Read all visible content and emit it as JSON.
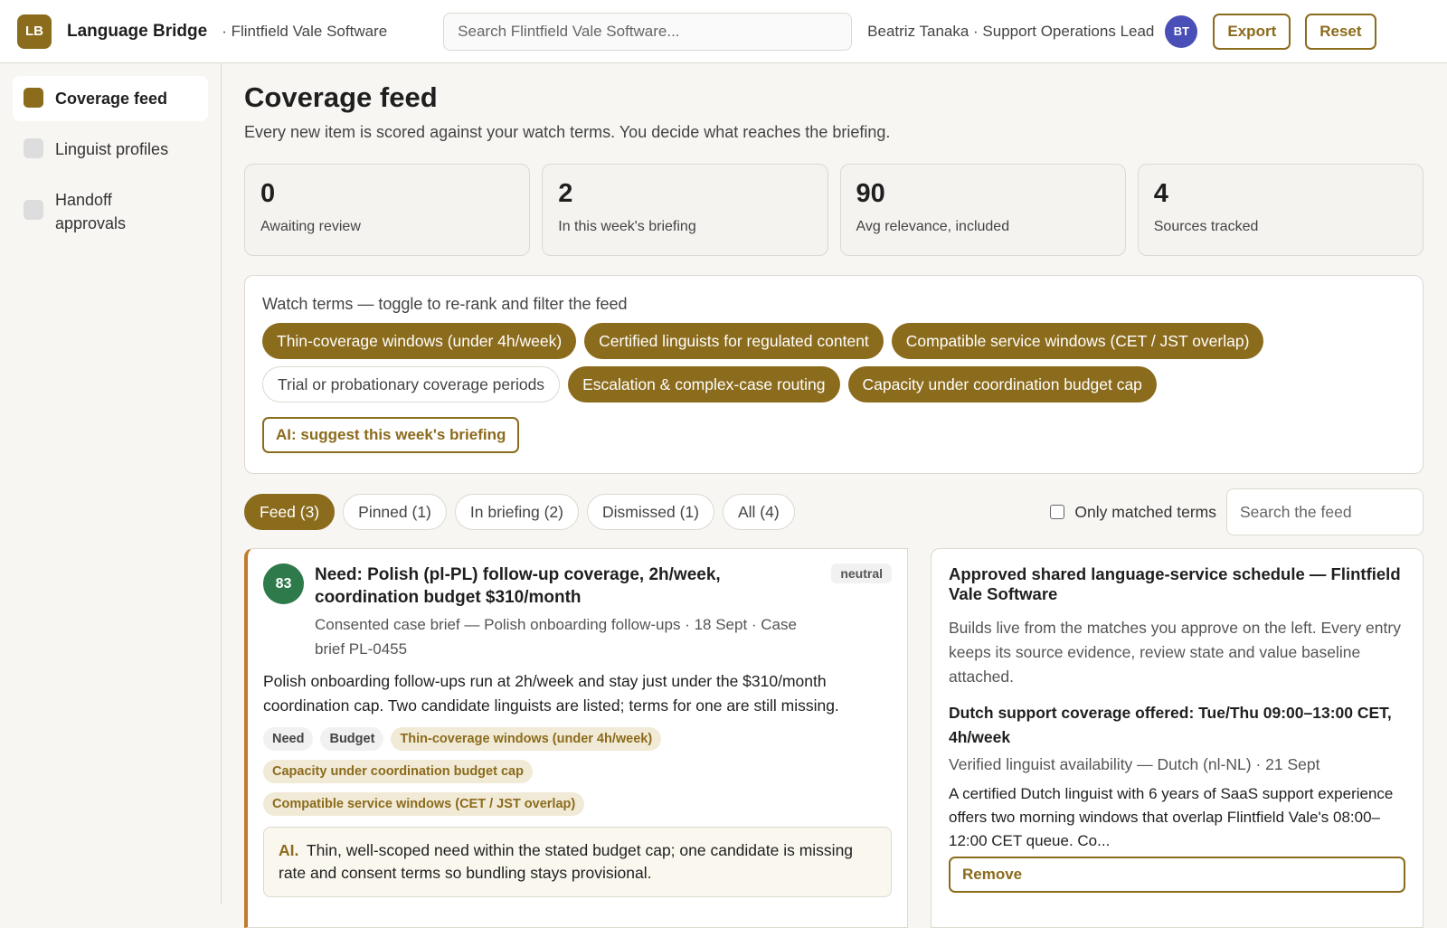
{
  "app": {
    "logo": "LB",
    "name": "Language Bridge",
    "org": "· Flintfield Vale Software",
    "search_placeholder": "Search Flintfield Vale Software...",
    "user": "Beatriz Tanaka · Support Operations Lead",
    "avatar": "BT",
    "export_label": "Export",
    "reset_label": "Reset"
  },
  "sidebar": {
    "items": [
      {
        "label": "Coverage feed",
        "active": true
      },
      {
        "label": "Linguist profiles",
        "active": false
      },
      {
        "label": "Handoff approvals",
        "active": false
      }
    ]
  },
  "page": {
    "title": "Coverage feed",
    "subtitle": "Every new item is scored against your watch terms. You decide what reaches the briefing."
  },
  "stats": [
    {
      "value": "0",
      "label": "Awaiting review"
    },
    {
      "value": "2",
      "label": "In this week's briefing"
    },
    {
      "value": "90",
      "label": "Avg relevance, included"
    },
    {
      "value": "4",
      "label": "Sources tracked"
    }
  ],
  "watch_terms": {
    "title": "Watch terms — toggle to re-rank and filter the feed",
    "terms": [
      {
        "label": "Thin-coverage windows (under 4h/week)",
        "on": true
      },
      {
        "label": "Certified linguists for regulated content",
        "on": true
      },
      {
        "label": "Compatible service windows (CET / JST overlap)",
        "on": true
      },
      {
        "label": "Trial or probationary coverage periods",
        "on": false
      },
      {
        "label": "Escalation & complex-case routing",
        "on": true
      },
      {
        "label": "Capacity under coordination budget cap",
        "on": true
      }
    ],
    "ai_button": "AI: suggest this week's briefing"
  },
  "filters": {
    "tabs": [
      "Feed (3)",
      "Pinned (1)",
      "In briefing (2)",
      "Dismissed (1)",
      "All (4)"
    ],
    "only_matched": "Only matched terms",
    "search_placeholder": "Search the feed"
  },
  "feed_item": {
    "score": "83",
    "title": "Need: Polish (pl-PL) follow-up coverage, 2h/week, coordination budget $310/month",
    "sentiment": "neutral",
    "meta": "Consented case brief — Polish onboarding follow-ups · 18 Sept · Case brief PL-0455",
    "body": "Polish onboarding follow-ups run at 2h/week and stay just under the $310/month coordination cap. Two candidate linguists are listed; terms for one are still missing.",
    "tags": [
      "Need",
      "Budget"
    ],
    "term_tags": [
      "Thin-coverage windows (under 4h/week)",
      "Capacity under coordination budget cap",
      "Compatible service windows (CET / JST overlap)"
    ],
    "ai_label": "AI.",
    "ai_note": "Thin, well-scoped need within the stated budget cap; one candidate is missing rate and consent terms so bundling stays provisional."
  },
  "schedule": {
    "title": "Approved shared language-service schedule — Flintfield Vale Software",
    "desc": "Builds live from the matches you approve on the left. Every entry keeps its source evidence, review state and value baseline attached.",
    "entry_title": "Dutch support coverage offered: Tue/Thu 09:00–13:00 CET, 4h/week",
    "entry_meta": "Verified linguist availability — Dutch (nl-NL) · 21 Sept",
    "entry_body": "A certified Dutch linguist with 6 years of SaaS support experience offers two morning windows that overlap Flintfield Vale's 08:00–12:00 CET queue. Co...",
    "remove_label": "Remove"
  },
  "colors": {
    "accent": "#8b6b1c",
    "score": "#2e7a4a",
    "avatar": "#4a4fb8"
  }
}
